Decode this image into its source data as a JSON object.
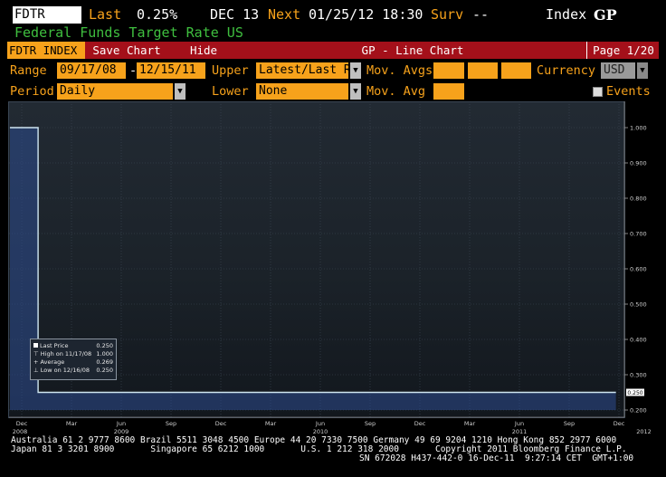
{
  "header": {
    "ticker": "FDTR",
    "last_label": "Last",
    "last_value": "0.25%",
    "date": "DEC 13",
    "next_label": "Next",
    "next_value": "01/25/12 18:30",
    "surv_label": "Surv",
    "surv_value": "--",
    "index_label": "Index",
    "function_code": "GP",
    "subtitle": "Federal Funds Target Rate US"
  },
  "toolbar": {
    "security": "FDTR INDEX",
    "save_chart": "Save Chart",
    "hide": "Hide",
    "chart_title": "GP - Line Chart",
    "page": "Page 1/20"
  },
  "controls": {
    "range_label": "Range",
    "range_start": "09/17/08",
    "range_sep": "-",
    "range_end": "12/15/11",
    "upper_label": "Upper",
    "upper_value": "Latest/Last Re",
    "mov_avgs_label": "Mov. Avgs",
    "currency_label": "Currency",
    "currency_value": "USD",
    "period_label": "Period",
    "period_value": "Daily",
    "lower_label": "Lower",
    "lower_value": "None",
    "mov_avg_label": "Mov. Avg",
    "events_label": "Events"
  },
  "legend": {
    "last_price_label": "Last Price",
    "last_price_value": "0.250",
    "high_label": "High on 11/17/08",
    "high_value": "1.000",
    "average_label": "Average",
    "average_value": "0.269",
    "low_label": "Low on 12/16/08",
    "low_value": "0.250"
  },
  "chart_data": {
    "type": "line",
    "series": [
      {
        "name": "Last Price",
        "x": [
          "2008-09-17",
          "2008-12-16",
          "2008-12-16",
          "2011-12-15"
        ],
        "values": [
          1.0,
          1.0,
          0.25,
          0.25
        ]
      }
    ],
    "ylim": [
      0.2,
      1.0
    ],
    "y_ticks": [
      "1.000",
      "0.900",
      "0.800",
      "0.700",
      "0.600",
      "0.500",
      "0.400",
      "0.300",
      "0.200"
    ],
    "last_value_label": "0.250",
    "x_month_ticks": [
      "Dec",
      "Mar",
      "Jun",
      "Sep",
      "Dec",
      "Mar",
      "Jun",
      "Sep",
      "Dec",
      "Mar",
      "Jun",
      "Sep",
      "Dec"
    ],
    "x_year_ticks": [
      "2008",
      "2009",
      "2010",
      "2011",
      "2012"
    ],
    "grid": true,
    "line_color": "#cfe6f2"
  },
  "footer": {
    "line1": "Australia 61 2 9777 8600 Brazil 5511 3048 4500 Europe 44 20 7330 7500 Germany 49 69 9204 1210 Hong Kong 852 2977 6000",
    "line2": "Japan 81 3 3201 8900       Singapore 65 6212 1000       U.S. 1 212 318 2000       Copyright 2011 Bloomberg Finance L.P.",
    "line3": "SN 672028 H437-442-0 16-Dec-11  9:27:14 CET  GMT+1:00"
  }
}
